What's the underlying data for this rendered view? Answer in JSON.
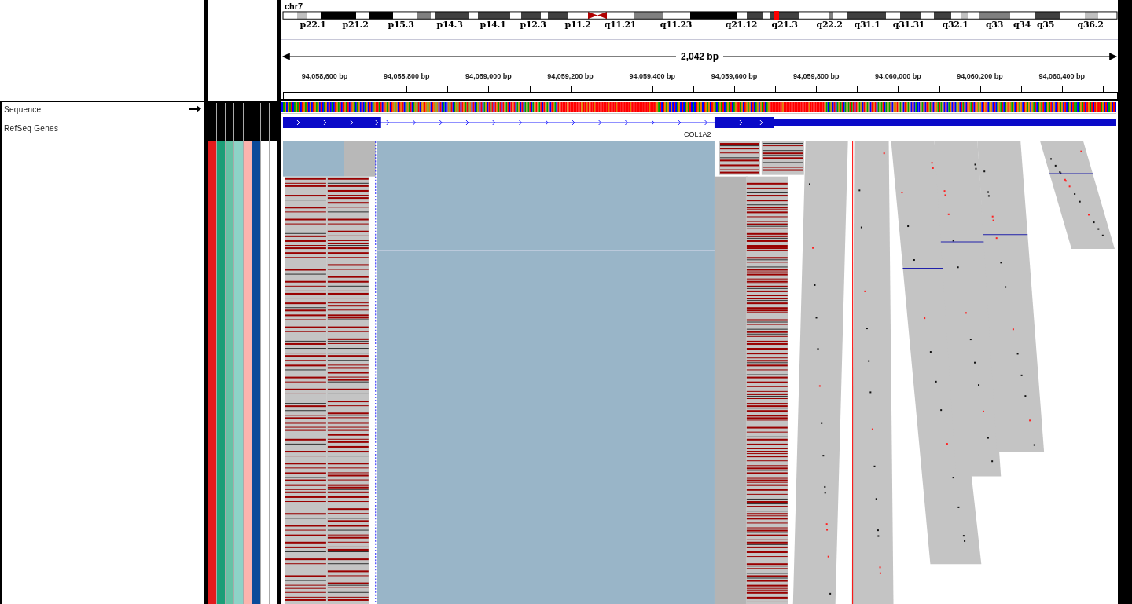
{
  "chromosome": "chr7",
  "cytobands": [
    "p22.1",
    "p21.2",
    "p15.3",
    "p14.3",
    "p14.1",
    "p12.3",
    "p11.2",
    "q11.21",
    "q11.23",
    "q21.12",
    "q21.3",
    "q22.2",
    "q31.1",
    "q31.31",
    "q32.1",
    "q33",
    "q34",
    "q35",
    "q36.2"
  ],
  "span": "2,042 bp",
  "ticks": [
    "94,058,600 bp",
    "94,058,800 bp",
    "94,059,000 bp",
    "94,059,200 bp",
    "94,059,400 bp",
    "94,059,600 bp",
    "94,059,800 bp",
    "94,060,000 bp",
    "94,060,200 bp",
    "94,060,400 bp"
  ],
  "tracks": [
    {
      "kind": "sequence",
      "name": "Sequence"
    },
    {
      "kind": "gene",
      "name": "RefSeq Genes",
      "gene": "COL1A2"
    }
  ],
  "attributes": [
    {
      "color": "#e31a1c"
    },
    {
      "color": "#1b9e77"
    },
    {
      "color": "#66c2a5"
    },
    {
      "color": "#8dd3c7"
    },
    {
      "color": "#fbb4ae"
    },
    {
      "color": "#0b4a9a"
    },
    {
      "color": "#ffffff"
    },
    {
      "color": "#ffffff"
    }
  ]
}
